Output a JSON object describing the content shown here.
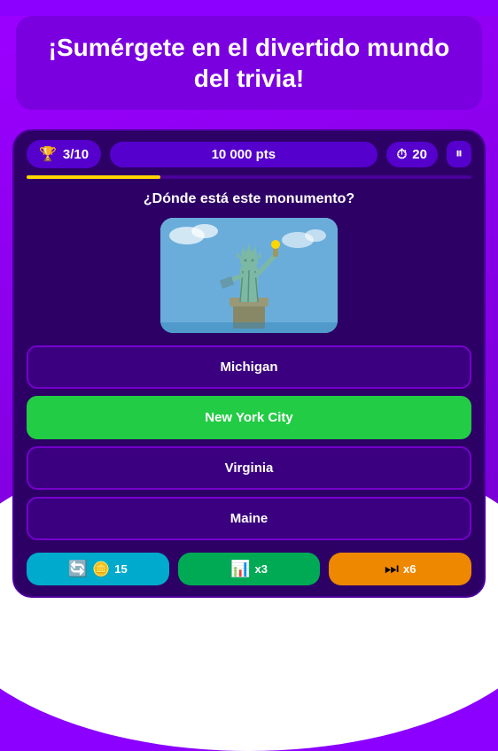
{
  "background": {
    "color": "#8B00FF"
  },
  "header": {
    "text": "¡Sumérgete en el divertido mundo del trivia!"
  },
  "game": {
    "score_label": "3/10",
    "points_label": "10 000 pts",
    "timer_label": "20",
    "progress_percent": 30,
    "question": "¿Dónde está este monumento?",
    "image_alt": "Estatua de la Libertad",
    "answers": [
      {
        "text": "Michigan",
        "correct": false
      },
      {
        "text": "New York City",
        "correct": true
      },
      {
        "text": "Virginia",
        "correct": false
      },
      {
        "text": "Maine",
        "correct": false
      }
    ],
    "powerups": [
      {
        "icon": "🔄",
        "value": "15",
        "type": "coin"
      },
      {
        "icon": "📊",
        "value": "x3",
        "type": "bar"
      },
      {
        "icon": "➡️",
        "value": "x6",
        "type": "arrow"
      }
    ]
  }
}
